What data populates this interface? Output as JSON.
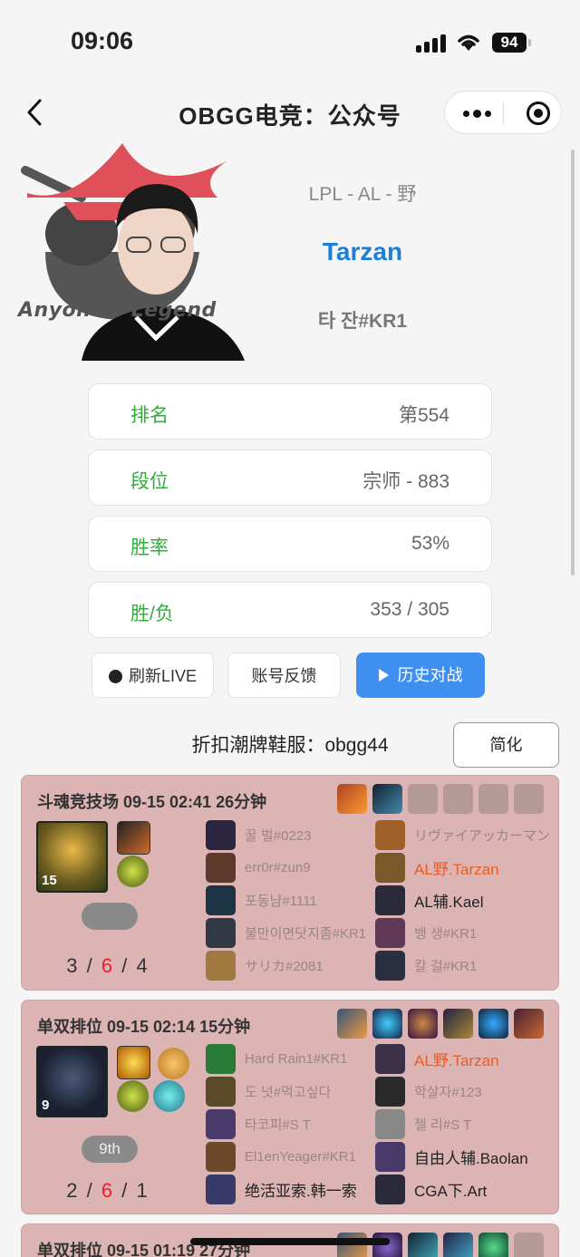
{
  "status": {
    "time": "09:06",
    "battery": "94"
  },
  "nav": {
    "title": "OBGG电竞：公众号"
  },
  "profile": {
    "logo_text": "Anyone's Legend",
    "role": "LPL - AL - 野",
    "name": "Tarzan",
    "tag": "타 잔#KR1"
  },
  "stats": [
    {
      "label": "排名",
      "value": "第554"
    },
    {
      "label": "段位",
      "value": "宗师 - 883"
    },
    {
      "label": "胜率",
      "value": "53%"
    },
    {
      "label": "胜/负",
      "value": "353 / 305"
    }
  ],
  "buttons": {
    "live": "刷新LIVE",
    "feedback": "账号反馈",
    "history": "历史对战",
    "simplify": "简化"
  },
  "promo": "折扣潮牌鞋服：obgg44",
  "matches": [
    {
      "header": "斗魂竞技场  09-15 02:41  26分钟",
      "level": "15",
      "place": "",
      "kills": "3",
      "deaths": "6",
      "assists": "4",
      "left": [
        "꿀 벌#0223",
        "err0r#zun9",
        "포동냠#1111",
        "불만이면닷지좀#KR1",
        "サリカ#2081"
      ],
      "right": [
        "リヴァイアッカーマン#",
        "AL野.Tarzan",
        "AL辅.Kael",
        "뱅 생#KR1",
        "칼 걸#KR1"
      ]
    },
    {
      "header": "单双排位  09-15 02:14  15分钟",
      "level": "9",
      "place": "9th",
      "kills": "2",
      "deaths": "6",
      "assists": "1",
      "left": [
        "Hard Rain1#KR1",
        "도 넛#먹고싶다",
        "타코피#S T",
        "El1enYeager#KR1",
        "绝活亚索.韩一索"
      ],
      "right": [
        "AL野.Tarzan",
        "학살자#123",
        "젤 리#S T",
        "自由人辅.Baolan",
        "CGA下.Art"
      ]
    },
    {
      "header": "单双排位  09-15 01:19  27分钟"
    }
  ]
}
